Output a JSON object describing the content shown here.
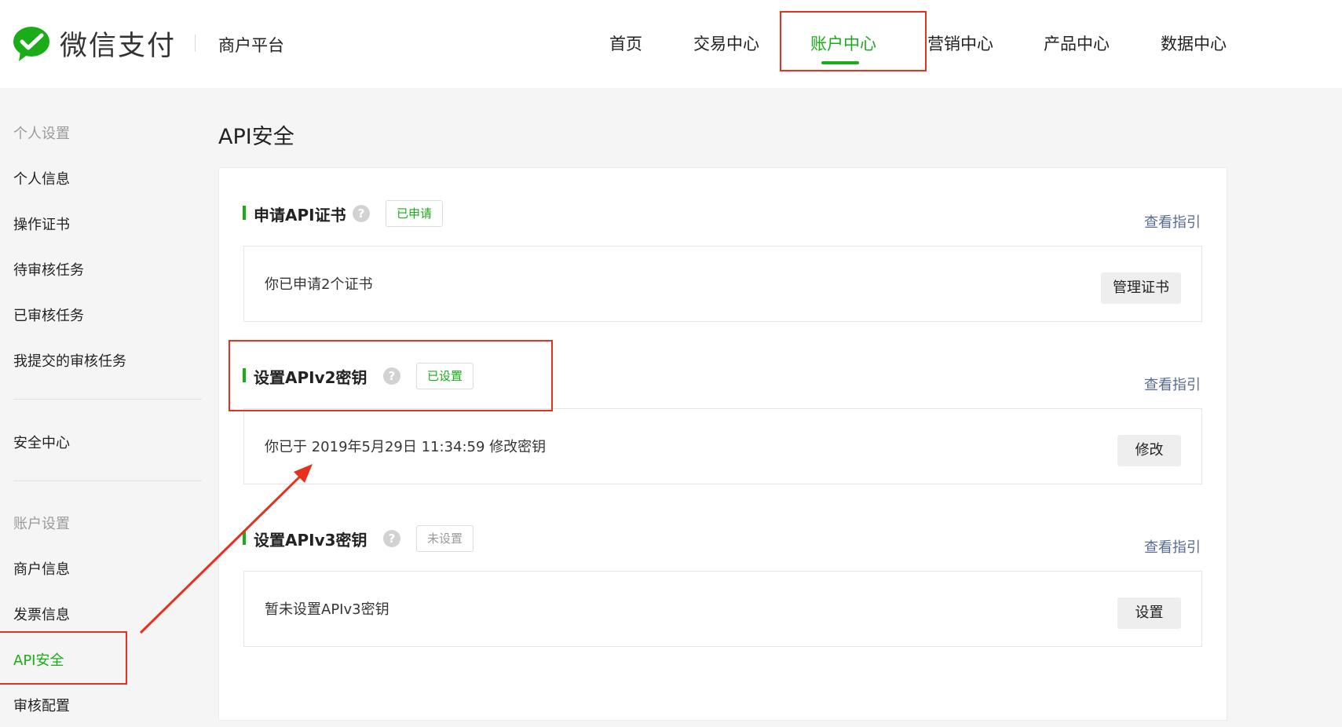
{
  "header": {
    "logo_text": "微信支付",
    "platform": "商户平台",
    "nav": [
      "首页",
      "交易中心",
      "账户中心",
      "营销中心",
      "产品中心",
      "数据中心"
    ],
    "active_nav": "账户中心"
  },
  "sidebar": {
    "group_personal": "个人设置",
    "personal_items": [
      "个人信息",
      "操作证书",
      "待审核任务",
      "已审核任务",
      "我提交的审核任务"
    ],
    "security": "安全中心",
    "group_account": "账户设置",
    "account_items": [
      "商户信息",
      "发票信息",
      "API安全",
      "审核配置"
    ],
    "active_item": "API安全"
  },
  "main": {
    "title": "API安全",
    "sections": [
      {
        "title": "申请API证书",
        "help": "?",
        "status": "已申请",
        "guide": "查看指引",
        "info": "你已申请2个证书",
        "button": "管理证书"
      },
      {
        "title": "设置APIv2密钥",
        "help": "?",
        "status": "已设置",
        "guide": "查看指引",
        "info": "你已于 2019年5月29日 11:34:59 修改密钥",
        "button": "修改"
      },
      {
        "title": "设置APIv3密钥",
        "help": "?",
        "status": "未设置",
        "guide": "查看指引",
        "info": "暂未设置APIv3密钥",
        "button": "设置"
      }
    ]
  },
  "colors": {
    "brand_green": "#1aad19",
    "link_blue": "#576b95",
    "annotation_red": "#e8301f"
  }
}
